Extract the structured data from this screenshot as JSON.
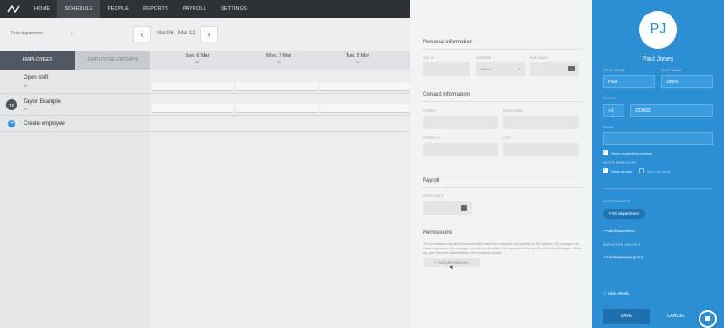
{
  "nav": {
    "items": [
      "HOME",
      "SCHEDULE",
      "PEOPLE",
      "REPORTS",
      "PAYROLL",
      "SETTINGS"
    ],
    "active": "SCHEDULE"
  },
  "toolbar": {
    "department": "First department",
    "date_range": "Mar 06 - Mar 12"
  },
  "grid": {
    "tabs": {
      "employees": "EMPLOYEES",
      "groups": "EMPLOYEE GROUPS"
    },
    "days": [
      {
        "label": "Sun. 6 Mar",
        "hours": "0h"
      },
      {
        "label": "Mon. 7 Mar",
        "hours": "0h"
      },
      {
        "label": "Tue. 8 Mar",
        "hours": "0h"
      }
    ],
    "open_shift": {
      "name": "Open shift",
      "hours": "0h"
    },
    "employee": {
      "initials": "TE",
      "name": "Taylor Example",
      "hours": "0h"
    },
    "create_label": "Create employee"
  },
  "panel": {
    "personal_title": "Personal information",
    "tax_label": "TAX ID",
    "gender_label": "GENDER",
    "gender_value": "Select...",
    "birthday_label": "BIRTHDAY",
    "contact_title": "Contact information",
    "street_label": "STREET",
    "postcode_label": "POSTCODE",
    "street2_label": "STREET 2",
    "city_label": "CITY",
    "payroll_title": "Payroll",
    "hired_label": "HIRED DATE",
    "permissions_title": "Permissions",
    "permissions_text": "The permissions list which administrative tasks the employee can perform in the system. HR manager can create employees but manager, but not create shifts. The opposite is the case for Schedule Manager. At the top, you'll find the Administrator with complete access.",
    "add_permissions": "+ Add permissions"
  },
  "side": {
    "initials": "PJ",
    "full_name": "Paul Jones",
    "first_label": "FIRST NAME",
    "first_value": "Paul",
    "last_label": "LAST NAME",
    "last_value": "Jones",
    "phone_label": "PHONE",
    "phone_code": "+1",
    "phone_value": "223432",
    "email_label": "EMAIL",
    "show_contact": "Show contact information",
    "invite_label": "INVITE EMPLOYEE",
    "send_sms": "Send as sms",
    "send_email": "Send as email",
    "departments_label": "DEPARTMENTS",
    "department_pill": "First department",
    "add_department": "+ Add department",
    "groups_label": "EMPLOYEE GROUPS",
    "add_group": "+ Add employee group",
    "hide_details": "Hide details",
    "save": "SAVE",
    "cancel": "CANCEL"
  },
  "colors": {
    "accent": "#2c8fd3",
    "topbar": "#2e3136"
  }
}
